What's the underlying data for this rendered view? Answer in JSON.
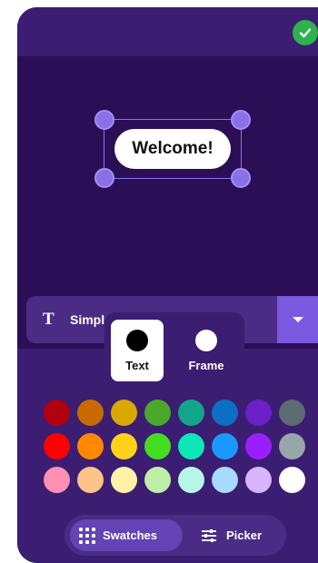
{
  "header": {
    "done_icon": "checkmark-icon",
    "done_color": "#2eb24c"
  },
  "canvas": {
    "text": "Welcome!"
  },
  "font_selector": {
    "icon": "text-t-icon",
    "icon_glyph": "T",
    "label": "Simple",
    "dropdown_icon": "chevron-down-icon"
  },
  "tabs": [
    {
      "label": "Text",
      "color": "#000000",
      "selected": true
    },
    {
      "label": "Frame",
      "color": "#ffffff",
      "selected": false
    }
  ],
  "swatches": [
    "#b10010",
    "#c86a00",
    "#d9a900",
    "#4aa82a",
    "#12a589",
    "#0c6fc2",
    "#6a1fc7",
    "#5e6b72",
    "#ff0000",
    "#ff8800",
    "#ffd21a",
    "#44dd22",
    "#0fe6b8",
    "#1a98ff",
    "#9a1fff",
    "#98a5ab",
    "#ff8fb3",
    "#ffc38a",
    "#fff1a8",
    "#bfeea6",
    "#b6f5e8",
    "#a8d9ff",
    "#d7b5ff",
    "#ffffff"
  ],
  "mode_bar": {
    "swatches_label": "Swatches",
    "swatches_icon": "grid-icon",
    "picker_label": "Picker",
    "picker_icon": "sliders-icon",
    "selected": "Swatches"
  }
}
